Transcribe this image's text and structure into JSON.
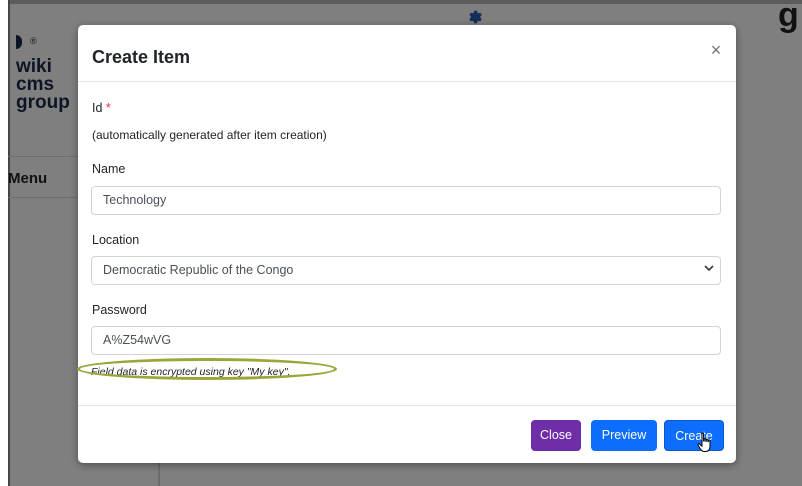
{
  "background": {
    "logo_lines": [
      "wiki",
      "cms",
      "group"
    ],
    "logo_reg": "®",
    "menu_label": "Menu",
    "heading_fragment": "g"
  },
  "modal": {
    "title": "Create Item",
    "close_glyph": "×",
    "fields": {
      "id": {
        "label": "Id",
        "required_mark": "*",
        "help_text": "(automatically generated after item creation)"
      },
      "name": {
        "label": "Name",
        "value": "Technology"
      },
      "location": {
        "label": "Location",
        "value": "Democratic Republic of the Congo"
      },
      "password": {
        "label": "Password",
        "value": "A%Z54wVG",
        "note": "Field data is encrypted using key \"My key\"."
      }
    },
    "buttons": {
      "close": "Close",
      "preview": "Preview",
      "create": "Create"
    }
  },
  "colors": {
    "primary": "#0d6efd",
    "close_button": "#6f2da8",
    "highlight_ellipse": "#9aa63a",
    "required": "#dc3545"
  },
  "icons": {
    "gear": "gear-icon",
    "chevron": "chevron-down-icon",
    "cursor": "hand-pointer-cursor-icon"
  }
}
